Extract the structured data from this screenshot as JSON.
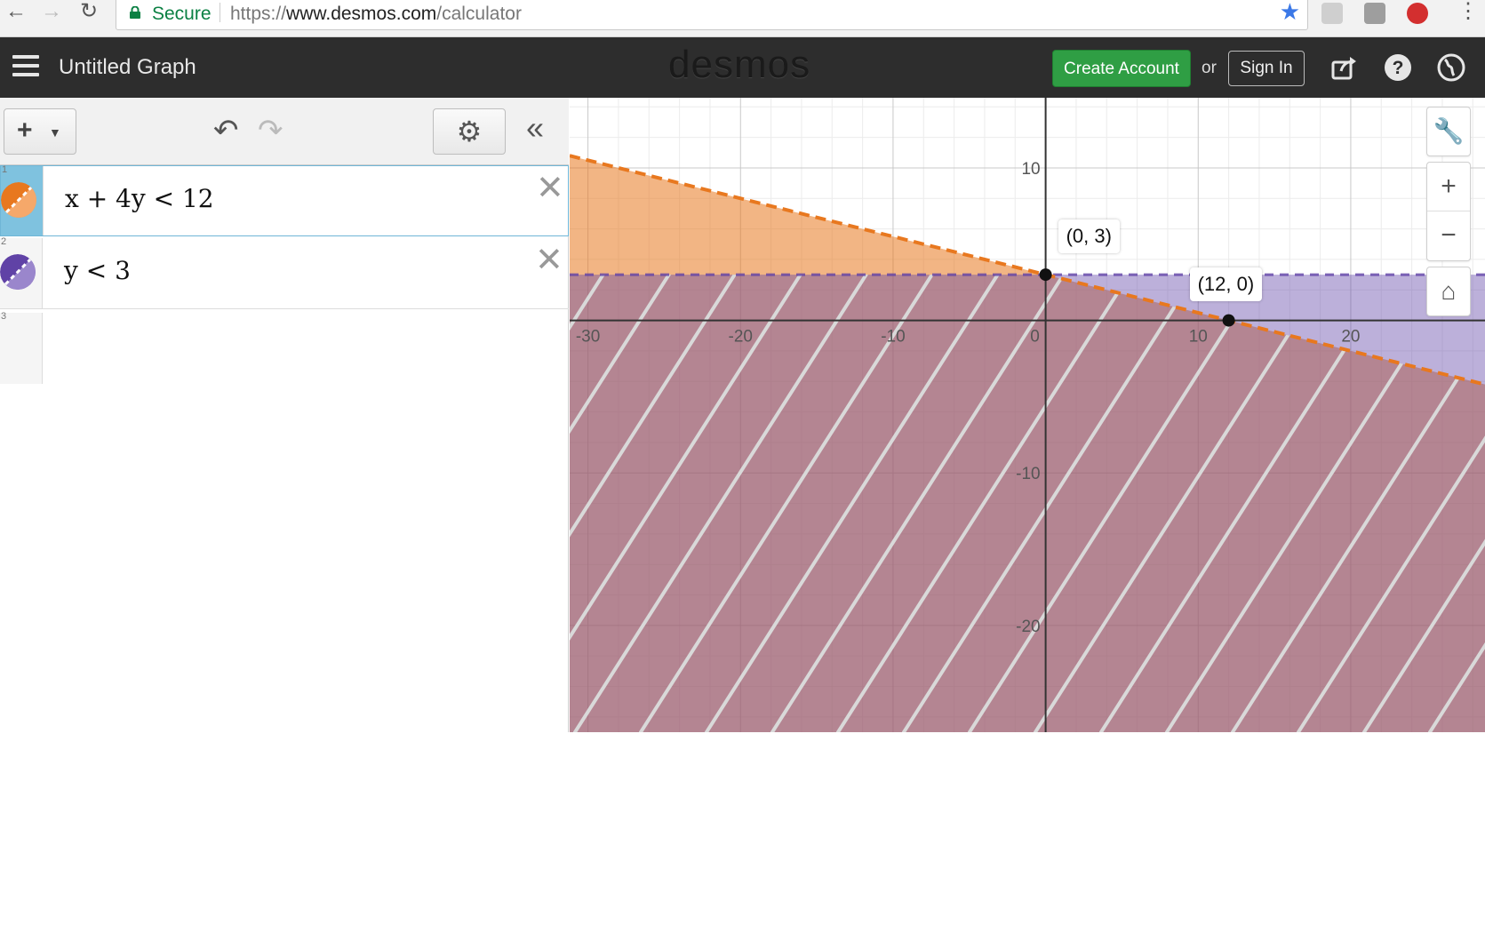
{
  "browser": {
    "secure_label": "Secure",
    "url_scheme": "https://",
    "url_host": "www.desmos.com",
    "url_path": "/calculator",
    "icons": [
      "back-arrow-icon",
      "forward-arrow-icon",
      "reload-icon",
      "lock-icon",
      "star-icon",
      "pdf-extension-icon",
      "extension-icon",
      "adblock-icon",
      "menu-kebab-icon"
    ]
  },
  "header": {
    "title": "Untitled Graph",
    "logo": "desmos",
    "create_account_label": "Create Account",
    "or_text": "or",
    "sign_in_label": "Sign In",
    "icons": [
      "hamburger-icon",
      "share-icon",
      "help-icon",
      "globe-icon"
    ]
  },
  "toolbar": {
    "add_label": "+",
    "icons": [
      "plus-icon",
      "chevron-down-icon",
      "undo-icon",
      "redo-icon",
      "gear-icon",
      "collapse-icon"
    ]
  },
  "expressions": [
    {
      "number": "1",
      "latex": "x + 4y < 12",
      "color": "#e8781f",
      "active": true
    },
    {
      "number": "2",
      "latex": "y < 3",
      "color": "#6042a6",
      "active": false
    },
    {
      "number": "3",
      "latex": "",
      "color": "",
      "active": false
    }
  ],
  "graph": {
    "x_ticks": [
      "-30",
      "-20",
      "-10",
      "0",
      "10",
      "20"
    ],
    "y_ticks": [
      "10",
      "-10",
      "-20"
    ],
    "x_range": [
      -31.2,
      28.8
    ],
    "y_range": [
      -27.0,
      14.6
    ],
    "points": [
      {
        "label": "(0, 3)",
        "x": 0,
        "y": 3
      },
      {
        "label": "(12, 0)",
        "x": 12,
        "y": 0
      }
    ],
    "colors": {
      "orange": "#e8781f",
      "purple": "#6042a6",
      "overlap": "#d4826b"
    },
    "tools": [
      "wrench-icon",
      "zoom-in-icon",
      "zoom-out-icon",
      "home-icon"
    ]
  }
}
